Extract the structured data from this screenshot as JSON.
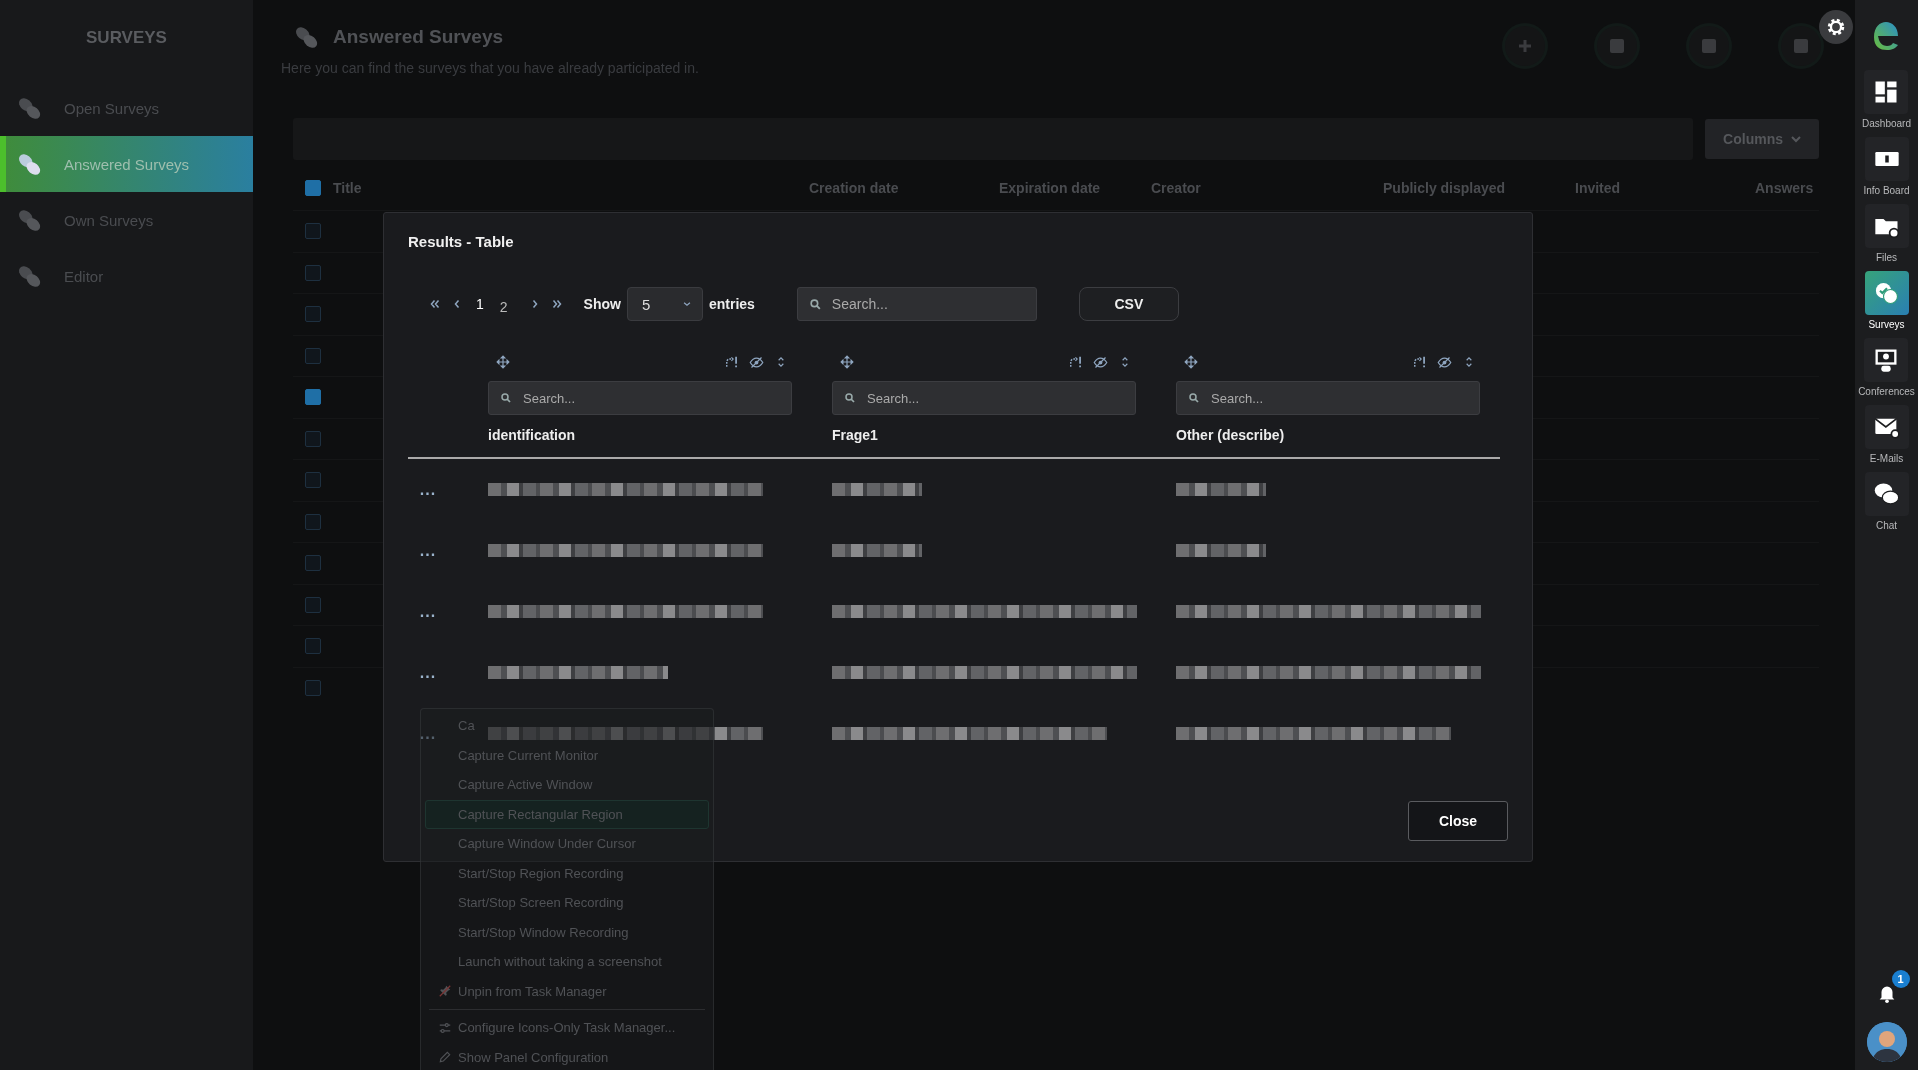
{
  "sidebar": {
    "title": "SURVEYS",
    "items": [
      {
        "label": "Open Surveys",
        "selected": false
      },
      {
        "label": "Answered Surveys",
        "selected": true
      },
      {
        "label": "Own Surveys",
        "selected": false
      },
      {
        "label": "Editor",
        "selected": false
      }
    ]
  },
  "page": {
    "title": "Answered Surveys",
    "description": "Here you can find the surveys that you have already participated in.",
    "toolbar": [
      {
        "kind": "plus"
      },
      {
        "kind": "square"
      },
      {
        "kind": "square"
      },
      {
        "kind": "square"
      }
    ],
    "columns_button": "Columns",
    "table": {
      "header_checked": true,
      "columns": [
        "Title",
        "Creation date",
        "Expiration date",
        "Creator",
        "Publicly displayed",
        "Invited",
        "Answers"
      ],
      "rows": [
        {
          "checked": false
        },
        {
          "checked": false
        },
        {
          "checked": false
        },
        {
          "checked": false
        },
        {
          "checked": true
        },
        {
          "checked": false
        },
        {
          "checked": false
        },
        {
          "checked": false
        },
        {
          "checked": false
        },
        {
          "checked": false
        },
        {
          "checked": false
        },
        {
          "checked": false
        }
      ]
    }
  },
  "modal": {
    "title": "Results - Table",
    "pages": [
      {
        "label": "1",
        "selected": true
      },
      {
        "label": "2",
        "selected": false
      }
    ],
    "show_label": "Show",
    "entries_value": "5",
    "entries_label": "entries",
    "search": {
      "placeholder": "Search..."
    },
    "export_button": "CSV",
    "columns": [
      {
        "label": "identification",
        "placeholder": "Search..."
      },
      {
        "label": "Frage1",
        "placeholder": "Search..."
      },
      {
        "label": "Other (describe)",
        "placeholder": "Search..."
      }
    ],
    "rows": [
      {
        "menu": "...",
        "cells": [
          {
            "kind": "redacted_long"
          },
          {
            "kind": "redacted_short"
          },
          {
            "kind": "redacted_short"
          }
        ]
      },
      {
        "menu": "...",
        "cells": [
          {
            "kind": "redacted_long"
          },
          {
            "kind": "redacted_short"
          },
          {
            "kind": "redacted_short"
          }
        ]
      },
      {
        "menu": "...",
        "cells": [
          {
            "kind": "redacted_long"
          },
          {
            "kind": "redacted_full"
          },
          {
            "kind": "redacted_full"
          }
        ]
      },
      {
        "menu": "...",
        "cells": [
          {
            "kind": "redacted_medium"
          },
          {
            "kind": "redacted_full"
          },
          {
            "kind": "redacted_full"
          }
        ]
      },
      {
        "menu": "...",
        "cells": [
          {
            "kind": "redacted_long"
          },
          {
            "kind": "redacted_long"
          },
          {
            "kind": "redacted_long"
          }
        ]
      }
    ],
    "close_button": "Close"
  },
  "context_menu": {
    "items": [
      {
        "label": "Ca",
        "kind": "text",
        "separator_before": false,
        "selected": false
      },
      {
        "label": "Capture Current Monitor",
        "kind": "text",
        "separator_before": false,
        "selected": false
      },
      {
        "label": "Capture Active Window",
        "kind": "text",
        "separator_before": false,
        "selected": false
      },
      {
        "label": "Capture Rectangular Region",
        "kind": "text",
        "separator_before": false,
        "selected": true
      },
      {
        "label": "Capture Window Under Cursor",
        "kind": "text",
        "separator_before": false,
        "selected": false
      },
      {
        "label": "Start/Stop Region Recording",
        "kind": "text",
        "separator_before": false,
        "selected": false
      },
      {
        "label": "Start/Stop Screen Recording",
        "kind": "text",
        "separator_before": false,
        "selected": false
      },
      {
        "label": "Start/Stop Window Recording",
        "kind": "text",
        "separator_before": false,
        "selected": false
      },
      {
        "label": "Launch without taking a screenshot",
        "kind": "text",
        "separator_before": false,
        "selected": false
      },
      {
        "label": "Unpin from Task Manager",
        "kind": "unpin",
        "separator_before": false,
        "selected": false
      },
      {
        "label": "Configure Icons-Only Task Manager...",
        "kind": "settings",
        "separator_before": true,
        "selected": false
      },
      {
        "label": "Show Panel Configuration",
        "kind": "edit",
        "separator_before": false,
        "selected": false
      }
    ]
  },
  "rail": {
    "items": [
      {
        "label": "Dashboard",
        "selected": false
      },
      {
        "label": "Info Board",
        "selected": false
      },
      {
        "label": "Files",
        "selected": false
      },
      {
        "label": "Surveys",
        "selected": true
      },
      {
        "label": "Conferences",
        "selected": false
      },
      {
        "label": "E-Mails",
        "selected": false
      },
      {
        "label": "Chat",
        "selected": false
      }
    ],
    "notification_count": "1"
  }
}
